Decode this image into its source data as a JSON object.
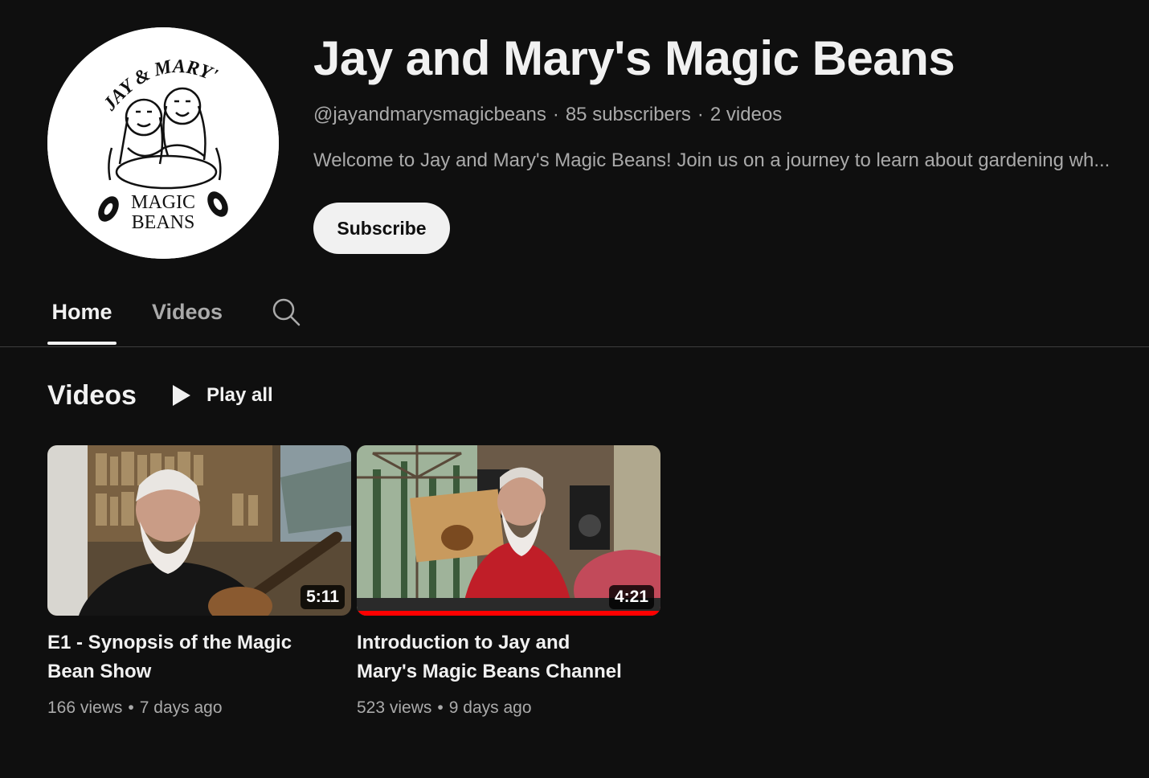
{
  "channel": {
    "name": "Jay and Mary's Magic Beans",
    "handle": "@jayandmarysmagicbeans",
    "subscribers": "85 subscribers",
    "video_count": "2 videos",
    "meta_separator": "·",
    "description": "Welcome to Jay and Mary's Magic Beans! Join us on a journey to learn about gardening wh...",
    "subscribe_label": "Subscribe",
    "avatar": {
      "text_top": "JAY & MARY'S",
      "text_bottom_1": "MAGIC",
      "text_bottom_2": "BEANS"
    }
  },
  "tabs": [
    {
      "label": "Home",
      "active": true
    },
    {
      "label": "Videos",
      "active": false
    }
  ],
  "section": {
    "title": "Videos",
    "play_all_label": "Play all"
  },
  "videos": [
    {
      "title": "E1 - Synopsis of the Magic Bean Show",
      "duration": "5:11",
      "views": "166 views",
      "age": "7 days ago",
      "watched_fraction": 0
    },
    {
      "title": "Introduction to Jay and Mary's Magic Beans Channel",
      "duration": "4:21",
      "views": "523 views",
      "age": "9 days ago",
      "watched_fraction": 1.0
    }
  ],
  "meta_dot": "•",
  "colors": {
    "background": "#0f0f0f",
    "text_primary": "#f1f1f1",
    "text_secondary": "#aaaaaa",
    "progress": "#ff0000"
  },
  "icons": {
    "search": "search-icon",
    "play": "play-icon"
  }
}
